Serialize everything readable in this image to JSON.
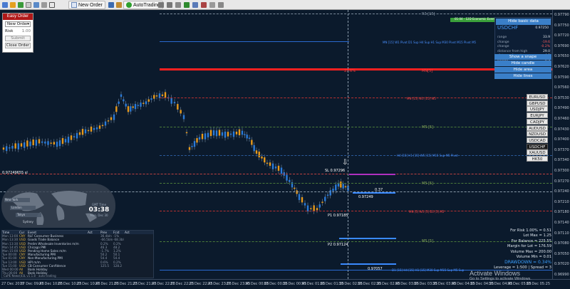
{
  "toolbar": {
    "new_order": "New Order",
    "auto_trading": "AutoTrading"
  },
  "easy_order": {
    "title": "Easy Order",
    "order_type": "New Order",
    "risk_label": "Risk",
    "risk_value": "1.00",
    "submit": "Submit",
    "close_order": "Close Order"
  },
  "info_panel": {
    "hide_button": "Hide basic data",
    "symbol": "USDCHF",
    "price": "0.97250",
    "rows": [
      {
        "label": "range",
        "value": "33.9",
        "red": false
      },
      {
        "label": "change",
        "value": "-19.6",
        "red": true
      },
      {
        "label": "change",
        "value": "-0.2%",
        "red": true
      },
      {
        "label": "distance from high",
        "value": "29.0",
        "red": false
      },
      {
        "label": "distance from low",
        "value": "4.9",
        "red": false
      },
      {
        "label": "spread",
        "value": "0.3",
        "red": false
      }
    ]
  },
  "actions": [
    "Show a snape",
    "Hide candle",
    "Hide area",
    "Hide lines"
  ],
  "symbols": [
    {
      "name": "EURUSD",
      "active": false
    },
    {
      "name": "GBPUSD",
      "active": false
    },
    {
      "name": "USDJPY",
      "active": false
    },
    {
      "name": "EURJPY",
      "active": false
    },
    {
      "name": "CADJPY",
      "active": false
    },
    {
      "name": "AUDUSD",
      "active": false
    },
    {
      "name": "NZDUSD",
      "active": false
    },
    {
      "name": "USDCAD",
      "active": false
    },
    {
      "name": "USDCHF",
      "active": true
    },
    {
      "name": "XAUUSD",
      "active": false
    },
    {
      "name": "HK50",
      "active": false
    }
  ],
  "y_axis": [
    "0.97790",
    "0.97750",
    "0.97720",
    "0.97690",
    "0.97650",
    "0.97620",
    "0.97590",
    "0.97560",
    "0.97530",
    "0.97490",
    "0.97460",
    "0.97430",
    "0.97400",
    "0.97370",
    "0.97340",
    "0.97300",
    "0.97270",
    "0.97240",
    "0.97210",
    "0.97180",
    "0.97140",
    "0.97110",
    "0.97080",
    "0.97050",
    "0.97020",
    "0.96990"
  ],
  "x_axis": [
    "27 Dec 2019",
    "27 Dec 09:45",
    "27 Dec 10:05",
    "27 Dec 10:25",
    "27 Dec 10:45",
    "27 Dec 21:05",
    "27 Dec 21:25",
    "27 Dec 21:45",
    "27 Dec 22:05",
    "27 Dec 22:25",
    "27 Dec 22:45",
    "27 Dec 23:05",
    "27 Dec 23:45",
    "30 Dec 00:05",
    "30 Dec 00:25",
    "30 Dec 00:45",
    "30 Dec 01:05",
    "30 Dec 01:25",
    "30 Dec 02:05",
    "30 Dec 02:25",
    "30 Dec 02:45",
    "30 Dec 03:05",
    "30 Dec 03:25",
    "30 Dec 03:45",
    "30 Dec 04:05",
    "30 Dec 04:25",
    "30 Dec 04:45",
    "30 Dec 05:05",
    "30 Dec 05:25"
  ],
  "levels": {
    "r3": "R3 [15]",
    "mn_pivot": "MN [15] W1 Pivot D1 Sup H4 Sup H1 Sup M30 Pivot M15 Pivot M5",
    "m5_red": "MN[5]",
    "pct": "23.6%",
    "r2": "MN [15] W1 [15] W5",
    "m5_mid": "M5 [5]",
    "h4_pivot": "H4 [15] H1 [15] W5 [15] M15 Sup M5 Pivot",
    "sl": "SL 0.97296",
    "m5_low": "M5 [5]",
    "price_tag": "0.97249",
    "sl_mark": "0.37",
    "p1": "P1 0.97185",
    "s_red": "MN [5] W1 [5] D1 [5] M5",
    "m5_s": "M5 [5]",
    "p2": "P2 0.97124",
    "p3": "0.97057",
    "bottom": "D1 [15] H4 [15] H1 [15] M30 Sup M15 Sup M5 Sup",
    "top_green": "01:04 - 12D Economic Events",
    "left_price": "0.97249655 sl"
  },
  "clock": {
    "label": "GMT Time",
    "time": "03:38",
    "date": "Mon, Dec 30"
  },
  "map_sessions": [
    "New York",
    "London",
    "Tokyo",
    "Sydney"
  ],
  "news_headers": [
    "Time",
    "Cur",
    "Event",
    "Act",
    "Prev",
    "Fcst",
    "Act"
  ],
  "news": [
    [
      "Mon 13:00",
      "CNY",
      "RLF Consumer Business",
      "",
      "36.4bln",
      "-1%",
      ""
    ],
    [
      "Mon 13:30",
      "USD",
      "Goods Trade Balance",
      "",
      "-66.5bln",
      "-68.3bl",
      ""
    ],
    [
      "Mon 13:30",
      "USD",
      "Prelim Wholesale Inventories m/m",
      "",
      "0.2%",
      "0.2%",
      ""
    ],
    [
      "Mon 14:45",
      "USD",
      "Chicago PMI",
      "",
      "46.3",
      "48.2",
      ""
    ],
    [
      "Mon 15:00",
      "USD",
      "Pending Home Sales m/m",
      "",
      "-1.7%",
      "1.2%",
      ""
    ],
    [
      "Tue 00:00",
      "CNY",
      "Manufacturing PMI",
      "",
      "50.2",
      "50.1",
      ""
    ],
    [
      "Tue 01:00",
      "CNY",
      "Non-Manufacturing PMI",
      "",
      "54.4",
      "54.4",
      ""
    ],
    [
      "Tue 13:00",
      "USD",
      "HPI m/m",
      "",
      "0.6%",
      "0.2%",
      ""
    ],
    [
      "Tue 15:00",
      "USD",
      "CB Consumer Confidence",
      "",
      "125.5",
      "128.2",
      ""
    ],
    [
      "Wed 00:00",
      "All",
      "Bank Holiday",
      "",
      "",
      "",
      ""
    ],
    [
      "Thu 00:00",
      "All",
      "Bank Holiday",
      "",
      "",
      "",
      ""
    ]
  ],
  "risk_panel": [
    "For Risk 1.00% = 0.51",
    "Lot Max = 1.25",
    "For Balance = 225.55",
    "Margin for Lot = 176.59",
    "Volume Max = 200.00",
    "Volume Min = 0.01",
    "DRAWDOWN = 0.34%",
    "Leverage = 1:500 | Spread = 3"
  ],
  "watermark": {
    "title": "Activate Windows",
    "sub": "Go to Settings to activate Windows."
  },
  "footer": "CaPE News(d3L v1.1.8 - auto trading"
}
